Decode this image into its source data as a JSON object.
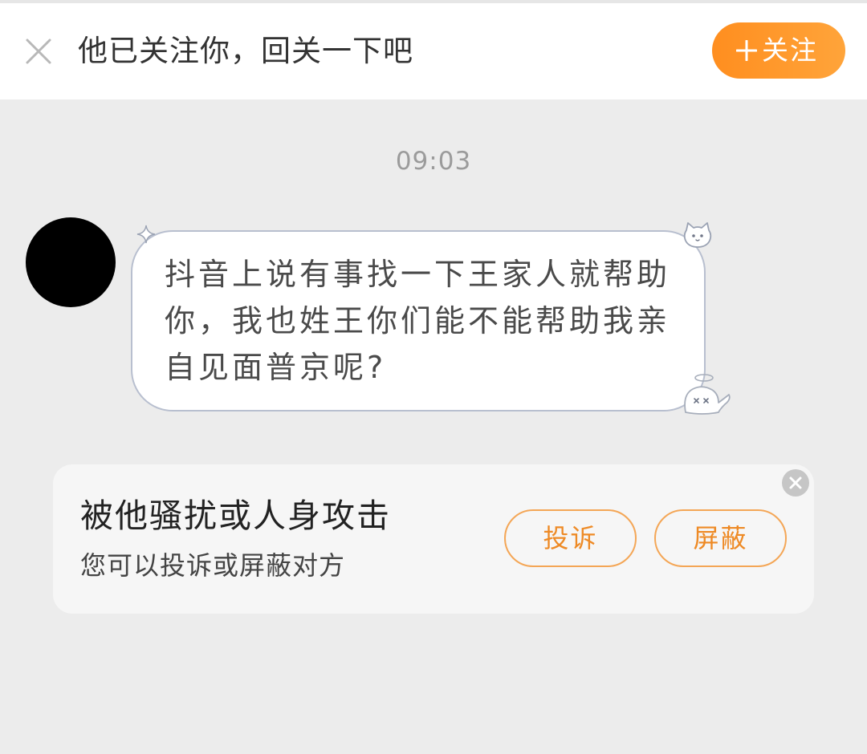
{
  "header": {
    "close_icon": "close-icon",
    "prompt": "他已关注你，回关一下吧",
    "follow_button": {
      "icon": "plus-icon",
      "label": "关注"
    }
  },
  "chat": {
    "timestamp": "09:03",
    "messages": [
      {
        "sender": "other",
        "avatar_color": "#000000",
        "text": "抖音上说有事找一下王家人就帮助你，我也姓王你们能不能帮助我亲自见面普京呢?",
        "bubble_decorations": [
          "sparkle-icon",
          "cat-icon",
          "ghost-icon"
        ]
      }
    ]
  },
  "report_card": {
    "title": "被他骚扰或人身攻击",
    "subtitle": "您可以投诉或屏蔽对方",
    "complain_label": "投诉",
    "block_label": "屏蔽",
    "dismiss_icon": "close-circle-icon"
  },
  "colors": {
    "accent": "#ff9a2e",
    "background": "#ececec",
    "bubble_border": "#b8bfcf"
  }
}
